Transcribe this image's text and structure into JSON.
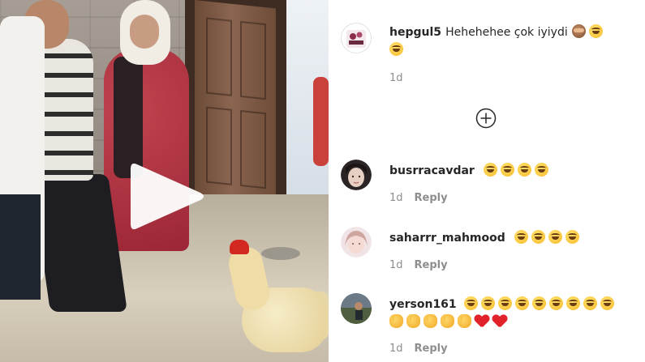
{
  "video": {
    "play_icon": "play-icon"
  },
  "comments": [
    {
      "username": "hepgul5",
      "text": "Hehehehee çok iyiydi",
      "emojis": [
        "monkey",
        "joy",
        "joy"
      ],
      "time": "1d",
      "reply": ""
    },
    {
      "username": "busrracavdar",
      "text": "",
      "emojis": [
        "joy",
        "joy",
        "joy",
        "joy"
      ],
      "time": "1d",
      "reply": "Reply"
    },
    {
      "username": "saharrr_mahmood",
      "text": "",
      "emojis": [
        "joy",
        "joy",
        "joy",
        "joy"
      ],
      "time": "1d",
      "reply": "Reply"
    },
    {
      "username": "yerson161",
      "text": "",
      "emojis": [
        "joy",
        "joy",
        "joy",
        "joy",
        "joy",
        "joy",
        "joy",
        "joy",
        "joy",
        "clap",
        "clap",
        "clap",
        "clap",
        "clap",
        "heart",
        "heart"
      ],
      "time": "1d",
      "reply": "Reply"
    }
  ],
  "load_more_icon": "plus-circle-icon",
  "colors": {
    "username": "#262626",
    "meta": "#8e8e8e",
    "play_button": "#ffffff"
  }
}
